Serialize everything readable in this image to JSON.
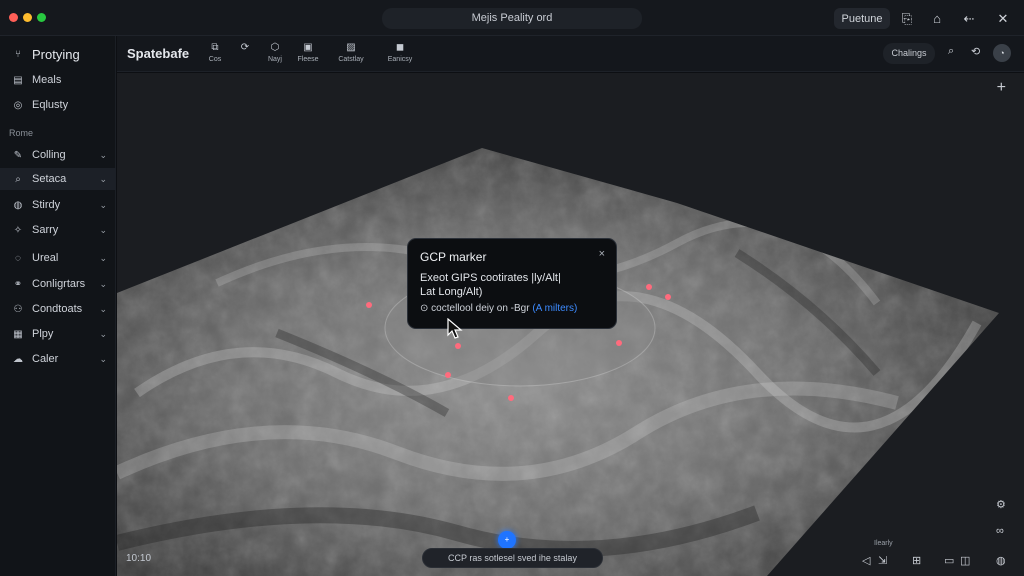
{
  "window": {
    "title": "Mejis Peality ord"
  },
  "titlebar": {
    "primary_label": "Puetune"
  },
  "sidebar": {
    "top_items": [
      {
        "label": "Protying",
        "icon": "fork-icon"
      },
      {
        "label": "Meals",
        "icon": "document-icon"
      },
      {
        "label": "Eqlusty",
        "icon": "target-icon"
      }
    ],
    "section_label": "Rome",
    "items": [
      {
        "label": "Colling",
        "icon": "brush-icon"
      },
      {
        "label": "Setaca",
        "icon": "search-icon"
      },
      {
        "label": "Stirdy",
        "icon": "globe-icon"
      },
      {
        "label": "Sarry",
        "icon": "star-icon"
      },
      {
        "label": "Ureal",
        "icon": "pin-icon"
      },
      {
        "label": "Conligrtars",
        "icon": "link-icon"
      },
      {
        "label": "Condtoats",
        "icon": "people-icon"
      },
      {
        "label": "Plpy",
        "icon": "grid-icon"
      },
      {
        "label": "Caler",
        "icon": "cloud-icon"
      }
    ]
  },
  "toolbar": {
    "brand": "Spatebafe",
    "tools": [
      {
        "label": "Cos",
        "icon": "frame-icon"
      },
      {
        "label": "",
        "icon": "refresh-icon"
      },
      {
        "label": "Nayj",
        "icon": "hexagon-icon"
      },
      {
        "label": "Fleese",
        "icon": "layers-icon"
      },
      {
        "label": "Catstlay",
        "icon": "image-icon"
      },
      {
        "label": "Eanicsy",
        "icon": "box-icon"
      }
    ],
    "right_label": "Chalings"
  },
  "popup": {
    "title": "GCP marker",
    "line1": "Exeot GIPS cootirates |ly/Alt|",
    "line2": "Lat Long/Alt)",
    "footer_prefix": "coctellool deiy on -Bgr",
    "footer_link": "(A milters)"
  },
  "status": {
    "time": "10:10",
    "bottom_pill": "CCP ras sotlesel sved ihe stalay",
    "blue_dot": "+",
    "corner_label": "Ilearly"
  },
  "colors": {
    "accent": "#1f74ff",
    "link": "#3d8bff",
    "marker": "#ff6b7d"
  }
}
